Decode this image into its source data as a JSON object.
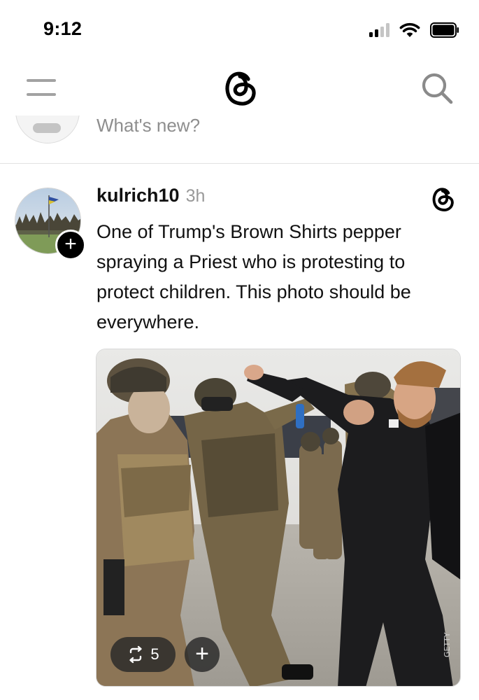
{
  "status_bar": {
    "time": "9:12",
    "icons": [
      "cellular-signal-icon",
      "wifi-icon",
      "battery-icon"
    ]
  },
  "nav": {
    "left_icon": "hamburger-menu-icon",
    "center_icon": "threads-logo-icon",
    "right_icon": "search-icon"
  },
  "composer": {
    "placeholder": "What's new?"
  },
  "post": {
    "username": "kulrich10",
    "time": "3h",
    "text": "One of Trump's Brown Shirts pepper spraying a Priest who is protesting to protect children. This photo should be everywhere.",
    "follow_label": "+",
    "image_alt": "Armed men in tactical camouflage gear; one pepper sprays a bearded man in black clothing",
    "repost_count": "5",
    "add_label": "+"
  },
  "colors": {
    "text": "#111111",
    "muted": "#8e8e8e",
    "divider": "#e2e2e2",
    "pill": "#282828"
  }
}
